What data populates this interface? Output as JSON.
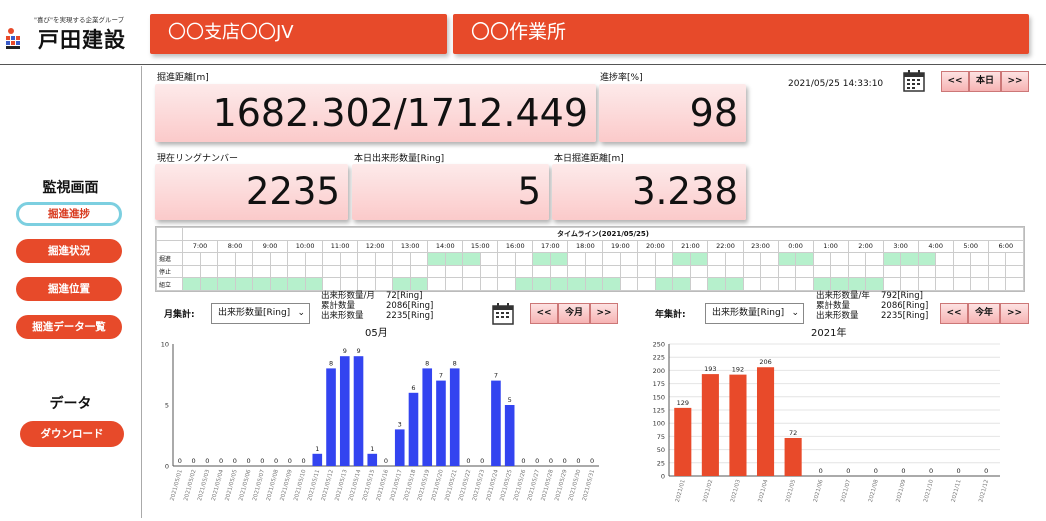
{
  "header": {
    "logo_tagline": "\"喜び\"を実現する企業グループ",
    "logo_name": "戸田建設",
    "branch": "〇〇支店〇〇JV",
    "site": "〇〇作業所"
  },
  "sidebar": {
    "monitor_heading": "監視画面",
    "items": [
      {
        "label": "掘進進捗",
        "active": true
      },
      {
        "label": "掘進状況",
        "active": false
      },
      {
        "label": "掘進位置",
        "active": false
      },
      {
        "label": "掘進データ一覧",
        "active": false
      }
    ],
    "data_heading": "データ",
    "download_label": "ダウンロード"
  },
  "metrics": {
    "distance_label": "掘進距離[m]",
    "distance_value": "1682.302/1712.449",
    "progress_label": "進捗率[%]",
    "progress_value": "98",
    "ring_label": "現在リングナンバー",
    "ring_value": "2235",
    "today_count_label": "本日出来形数量[Ring]",
    "today_count_value": "5",
    "today_distance_label": "本日掘進距離[m]",
    "today_distance_value": "3.238"
  },
  "datetime": "2021/05/25 14:33:10",
  "day_nav": {
    "prev": "<<",
    "current": "本日",
    "next": ">>"
  },
  "timeline": {
    "title": "タイムライン(2021/05/25)",
    "hours": [
      "7:00",
      "8:00",
      "9:00",
      "10:00",
      "11:00",
      "12:00",
      "13:00",
      "14:00",
      "15:00",
      "16:00",
      "17:00",
      "18:00",
      "19:00",
      "20:00",
      "21:00",
      "22:00",
      "23:00",
      "0:00",
      "1:00",
      "2:00",
      "3:00",
      "4:00",
      "5:00",
      "6:00"
    ],
    "rows": [
      {
        "label": "掘進",
        "on": [
          14,
          15,
          16,
          20,
          21,
          28,
          29,
          34,
          35,
          40,
          41,
          42,
          48
        ]
      },
      {
        "label": "停止",
        "on": []
      },
      {
        "label": "組立",
        "on": [
          0,
          1,
          2,
          3,
          4,
          5,
          6,
          7,
          12,
          13,
          19,
          20,
          21,
          22,
          23,
          24,
          27,
          28,
          30,
          31,
          36,
          37,
          38,
          39
        ]
      }
    ]
  },
  "month_summary": {
    "label": "月集計:",
    "select": "出来形数量[Ring]",
    "stats": [
      {
        "name": "出来形数量/月",
        "value": "72[Ring]"
      },
      {
        "name": "累計数量",
        "value": "2086[Ring]"
      },
      {
        "name": "出来形数量",
        "value": "2235[Ring]"
      }
    ],
    "nav": {
      "prev": "<<",
      "current": "今月",
      "next": ">>"
    }
  },
  "year_summary": {
    "label": "年集計:",
    "select": "出来形数量[Ring]",
    "stats": [
      {
        "name": "出来形数量/年",
        "value": "792[Ring]"
      },
      {
        "name": "累計数量",
        "value": "2086[Ring]"
      },
      {
        "name": "出来形数量",
        "value": "2235[Ring]"
      }
    ],
    "nav": {
      "prev": "<<",
      "current": "今年",
      "next": ">>"
    }
  },
  "chart_data": [
    {
      "type": "bar",
      "title": "05月",
      "color": "#3344f0",
      "ylim": [
        0,
        10
      ],
      "yticks": [
        0,
        5,
        10
      ],
      "categories": [
        "2021/05/01",
        "2021/05/02",
        "2021/05/03",
        "2021/05/04",
        "2021/05/05",
        "2021/05/06",
        "2021/05/07",
        "2021/05/08",
        "2021/05/09",
        "2021/05/10",
        "2021/05/11",
        "2021/05/12",
        "2021/05/13",
        "2021/05/14",
        "2021/05/15",
        "2021/05/16",
        "2021/05/17",
        "2021/05/18",
        "2021/05/19",
        "2021/05/20",
        "2021/05/21",
        "2021/05/22",
        "2021/05/23",
        "2021/05/24",
        "2021/05/25",
        "2021/05/26",
        "2021/05/27",
        "2021/05/28",
        "2021/05/29",
        "2021/05/30",
        "2021/05/31"
      ],
      "values": [
        0,
        0,
        0,
        0,
        0,
        0,
        0,
        0,
        0,
        0,
        1,
        8,
        9,
        9,
        1,
        0,
        3,
        6,
        8,
        7,
        8,
        0,
        0,
        7,
        5,
        0,
        0,
        0,
        0,
        0,
        0
      ]
    },
    {
      "type": "bar",
      "title": "2021年",
      "color": "#e84a2a",
      "ylim": [
        0,
        250
      ],
      "yticks": [
        0,
        25,
        50,
        75,
        100,
        125,
        150,
        175,
        200,
        225,
        250
      ],
      "grid": true,
      "categories": [
        "2021/01",
        "2021/02",
        "2021/03",
        "2021/04",
        "2021/05",
        "2021/06",
        "2021/07",
        "2021/08",
        "2021/09",
        "2021/10",
        "2021/11",
        "2021/12"
      ],
      "values": [
        129,
        193,
        192,
        206,
        72,
        0,
        0,
        0,
        0,
        0,
        0,
        0
      ]
    }
  ]
}
